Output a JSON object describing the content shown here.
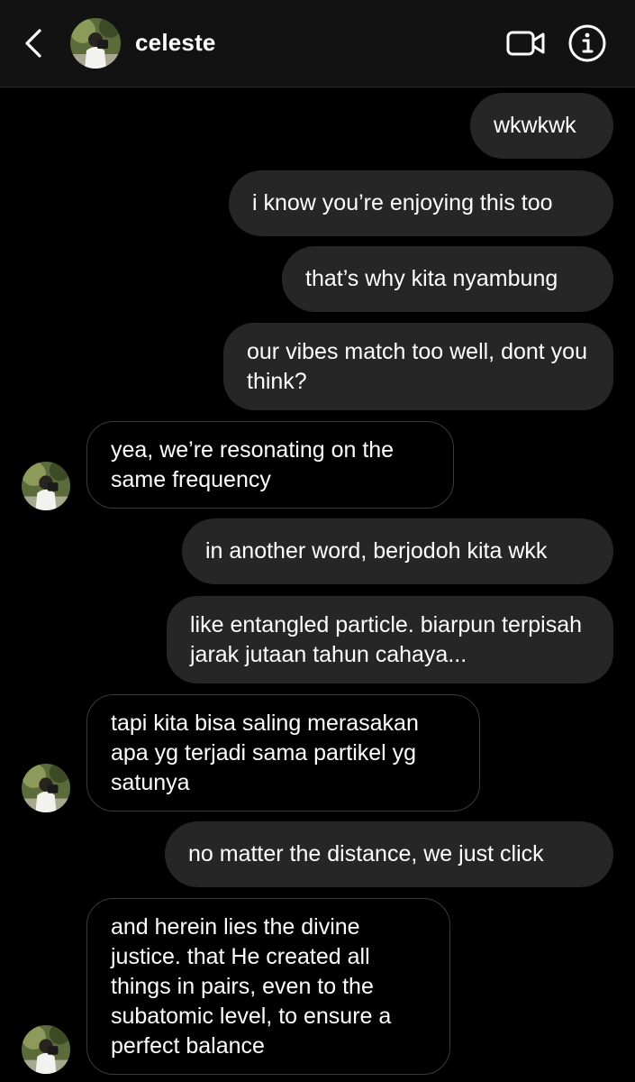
{
  "header": {
    "contact_name": "celeste",
    "back_icon": "chevron-left-icon",
    "video_icon": "video-camera-icon",
    "info_icon": "info-icon"
  },
  "messages": [
    {
      "direction": "out",
      "text": "wkwkwk"
    },
    {
      "direction": "out",
      "text": "i know you’re enjoying this too"
    },
    {
      "direction": "out",
      "text": "that’s why kita nyambung"
    },
    {
      "direction": "out",
      "text": "our vibes match too well, dont you think?"
    },
    {
      "direction": "in",
      "text": "yea, we’re resonating on the same frequency"
    },
    {
      "direction": "out",
      "text": "in another word, berjodoh kita wkk"
    },
    {
      "direction": "out",
      "text": "like entangled particle. biarpun terpisah jarak jutaan tahun cahaya..."
    },
    {
      "direction": "in",
      "text": "tapi kita bisa saling merasakan apa yg terjadi sama partikel yg satunya"
    },
    {
      "direction": "out",
      "text": "no matter the distance, we just click"
    },
    {
      "direction": "in",
      "text": "and herein lies the divine justice. that He created all things in pairs, even to the subatomic level, to ensure a perfect balance"
    }
  ],
  "colors": {
    "background": "#000000",
    "header": "#121212",
    "outgoing_bubble": "#262626",
    "incoming_border": "#3a3a3a",
    "text": "#ffffff"
  }
}
